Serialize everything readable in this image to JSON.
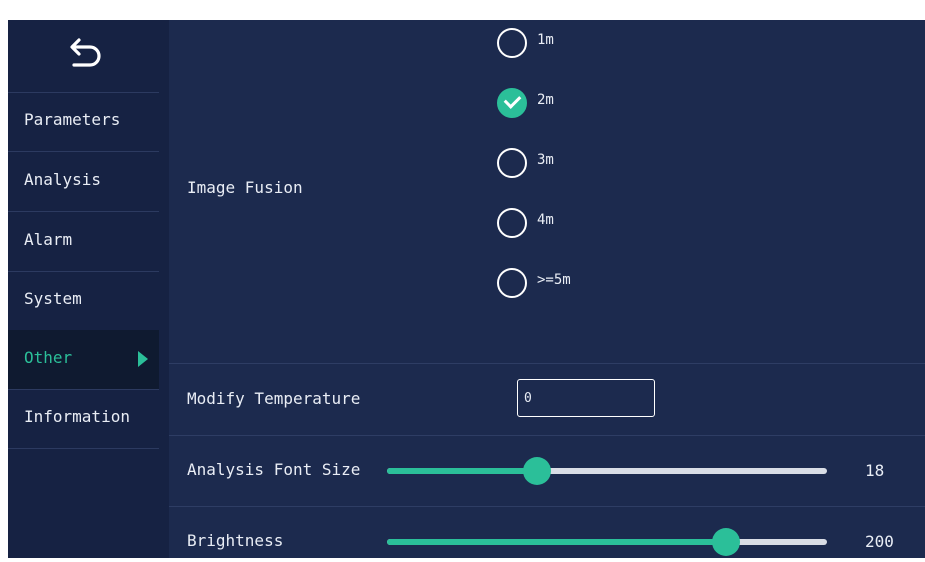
{
  "sidebar": {
    "items": [
      {
        "label": "Parameters"
      },
      {
        "label": "Analysis"
      },
      {
        "label": "Alarm"
      },
      {
        "label": "System"
      },
      {
        "label": "Other",
        "active": true
      },
      {
        "label": "Information"
      }
    ]
  },
  "image_fusion": {
    "label": "Image Fusion",
    "options": [
      "1m",
      "2m",
      "3m",
      "4m",
      ">=5m"
    ],
    "selected": "2m"
  },
  "modify_temperature": {
    "label": "Modify Temperature",
    "value": "0"
  },
  "analysis_font_size": {
    "label": "Analysis Font Size",
    "value": "18",
    "fraction": 0.34
  },
  "brightness": {
    "label": "Brightness",
    "value": "200",
    "fraction": 0.77
  },
  "colors": {
    "accent": "#2bbf99",
    "background": "#1c2a4e",
    "sidebar": "#162243"
  },
  "icons": {
    "back": "back-arrow-icon",
    "active_marker": "triangle-right-icon",
    "selected_radio": "check-icon"
  }
}
